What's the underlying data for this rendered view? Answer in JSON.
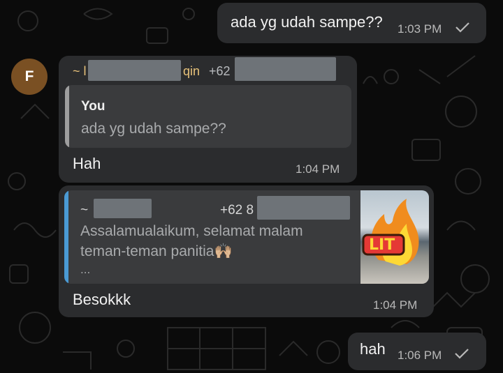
{
  "theme": {
    "accent_quote_bar_self": "#9e9e9e",
    "accent_quote_bar_other": "#4a9ad4",
    "sender_color": "#e8c27a",
    "avatar_bg": "#7a5023"
  },
  "messages": [
    {
      "text": "ada yg udah sampe??",
      "time": "1:03 PM",
      "status_icon": "single-check-icon"
    },
    {
      "avatar_letter": "F",
      "sender_prefix": "~ l",
      "sender_suffix": "qin",
      "sender_phone_prefix": "+62",
      "quote_author": "You",
      "quote_text": "ada yg udah sampe??",
      "text": "Hah",
      "time": "1:04 PM"
    },
    {
      "quote_author_prefix": "~",
      "quote_phone_prefix": "+62 8",
      "quote_line1": "Assalamualaikum, selamat malam",
      "quote_line2": "teman-teman panitia🙌🏼",
      "quote_more": "...",
      "thumb_sticker_text": "LIT",
      "text": "Besokkk",
      "time": "1:04 PM"
    },
    {
      "text": "hah",
      "time": "1:06 PM",
      "status_icon": "single-check-icon"
    }
  ]
}
